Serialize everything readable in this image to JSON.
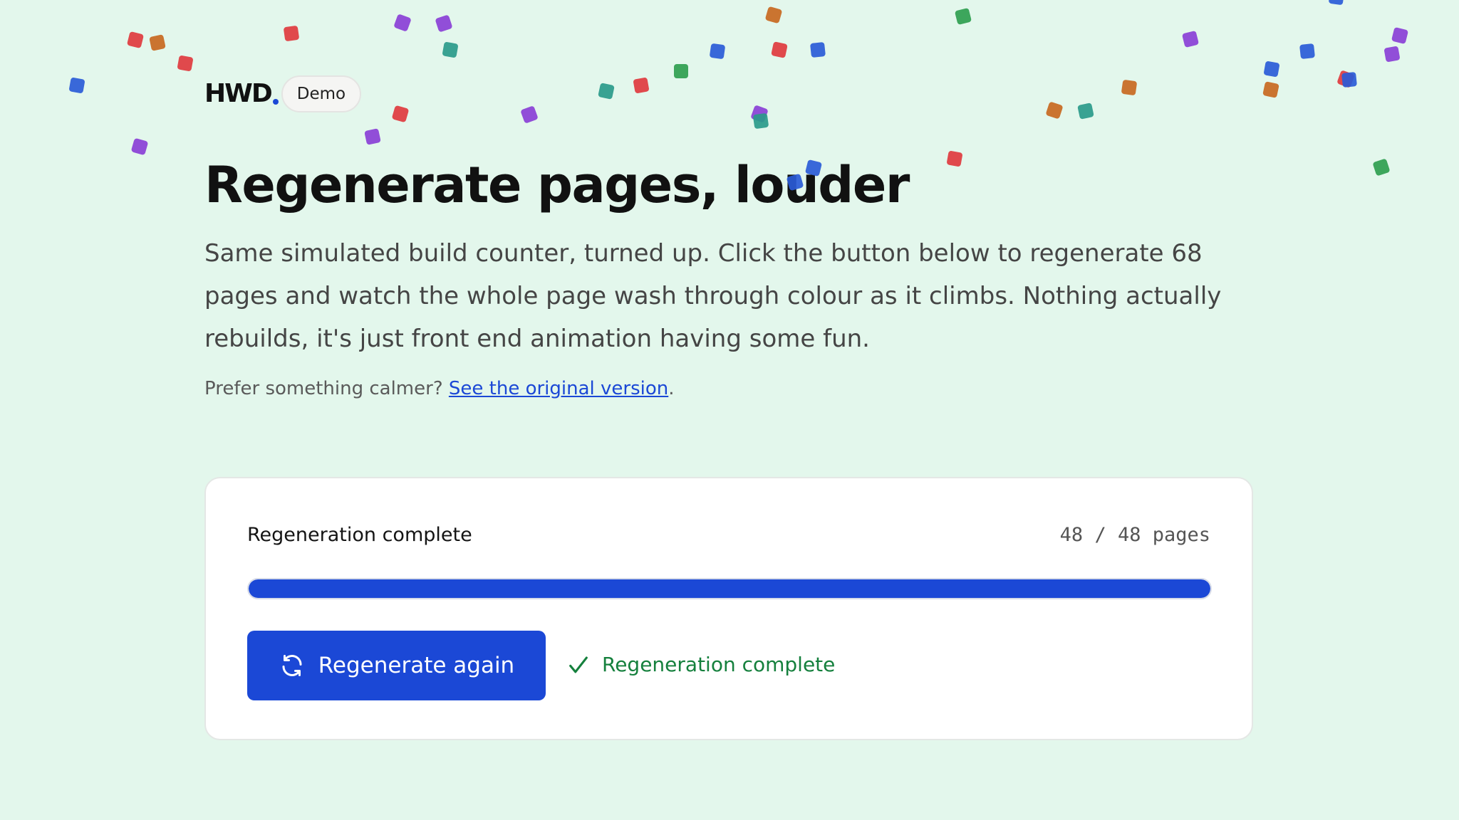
{
  "brand": {
    "logo_text": "HWD",
    "badge": "Demo"
  },
  "hero": {
    "title": "Regenerate pages, louder",
    "lede": "Same simulated build counter, turned up. Click the button below to regenerate 68 pages and watch the whole page wash through colour as it climbs. Nothing actually rebuilds, it's just front end animation having some fun.",
    "calmer_prefix": "Prefer something calmer?",
    "calmer_link": "See the original version",
    "calmer_suffix": "."
  },
  "progress": {
    "status_label": "Regeneration complete",
    "count_text": "48 / 48 pages",
    "fraction": 1.0,
    "button_label": "Regenerate again",
    "button_icon": "refresh-icon",
    "complete_message": "Regeneration complete",
    "complete_icon": "check-icon"
  },
  "colors": {
    "background": "#e3f7ec",
    "accent": "#1b48d6",
    "success": "#15803d",
    "confetti_palette": [
      "#e0393e",
      "#c8681f",
      "#8a3fd6",
      "#2a9a8a",
      "#2f9e4f",
      "#2a5bd7"
    ]
  }
}
